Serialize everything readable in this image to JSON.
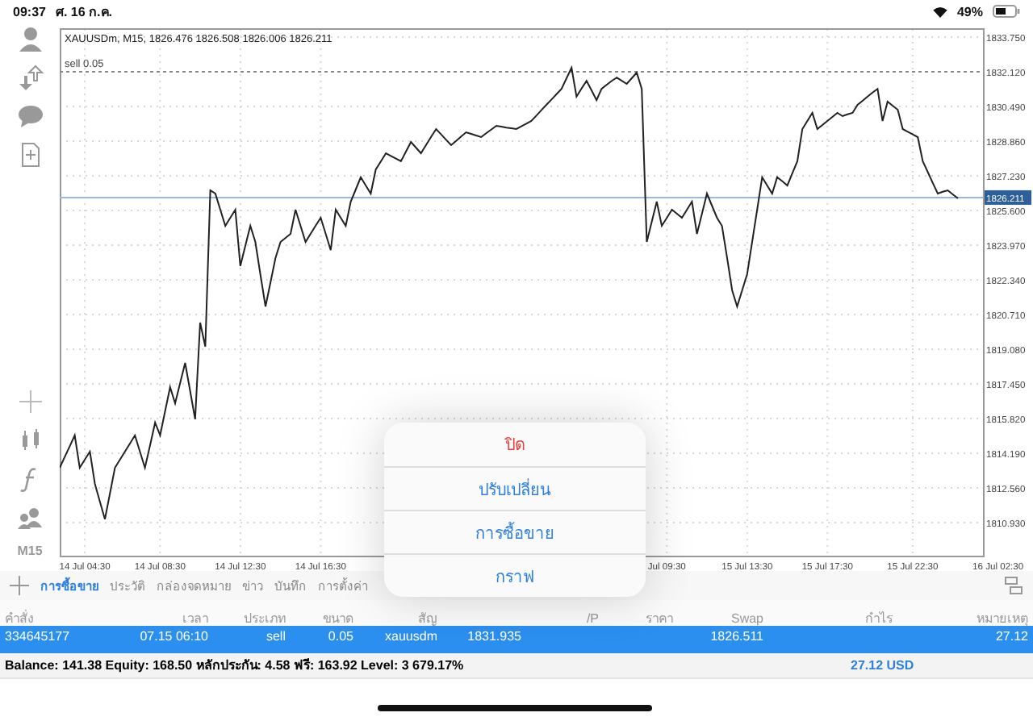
{
  "status_bar": {
    "time": "09:37",
    "date": "ศ. 16 ก.ค.",
    "battery": "49%"
  },
  "toolbar": {
    "timeframe": "M15"
  },
  "chart": {
    "chart_data": {
      "type": "line",
      "title": "XAUUSDm, M15, 1826.476 1826.508 1826.006 1826.211",
      "ylim": [
        1809.34,
        1834.13
      ],
      "grid": true,
      "categories": [
        null,
        null,
        null,
        null,
        null,
        "14 Jul 04:30",
        null,
        null,
        null,
        null,
        null,
        null,
        null,
        null,
        null,
        null,
        null,
        null,
        null,
        null,
        "14 Jul 08:30",
        null,
        null,
        null,
        null,
        null,
        null,
        null,
        null,
        null,
        null,
        null,
        null,
        null,
        null,
        null,
        "14 Jul 12:30",
        null,
        null,
        null,
        null,
        null,
        null,
        null,
        null,
        null,
        null,
        null,
        null,
        null,
        null,
        null,
        "14 Jul 16:30",
        null,
        null,
        null,
        null,
        null,
        null,
        null,
        null,
        null,
        null,
        null,
        null,
        null,
        null,
        null,
        null,
        null,
        null,
        null,
        null,
        null,
        null,
        null,
        null,
        null,
        null,
        null,
        null,
        null,
        null,
        null,
        null,
        null,
        null,
        null,
        null,
        null,
        null,
        null,
        null,
        null,
        null,
        null,
        null,
        null,
        null,
        null,
        null,
        null,
        null,
        null,
        null,
        null,
        null,
        null,
        null,
        null,
        null,
        null,
        null,
        null,
        null,
        null,
        null,
        null,
        null,
        null,
        null,
        "Jul 09:30",
        null,
        null,
        null,
        null,
        null,
        null,
        null,
        null,
        null,
        null,
        null,
        null,
        null,
        null,
        null,
        "15 Jul 13:30",
        null,
        null,
        null,
        null,
        null,
        null,
        null,
        null,
        null,
        null,
        null,
        null,
        null,
        null,
        null,
        "15 Jul 17:30",
        null,
        null,
        null,
        null,
        null,
        null,
        null,
        null,
        null,
        null,
        null,
        null,
        null,
        null,
        null,
        null,
        "15 Jul 22:30",
        null,
        null,
        null,
        null,
        null,
        null,
        null,
        null,
        null,
        null,
        null,
        null,
        null,
        null,
        null,
        null,
        "16 Jul 02:30"
      ],
      "yticks": [
        {
          "value": 1833.75,
          "label": "1833.750"
        },
        {
          "value": 1832.12,
          "label": "1832.120"
        },
        {
          "value": 1830.49,
          "label": "1830.490"
        },
        {
          "value": 1828.86,
          "label": "1828.860"
        },
        {
          "value": 1827.23,
          "label": "1827.230"
        },
        {
          "value": 1825.6,
          "label": "1825.600"
        },
        {
          "value": 1823.97,
          "label": "1823.970"
        },
        {
          "value": 1822.34,
          "label": "1822.340"
        },
        {
          "value": 1820.71,
          "label": "1820.710"
        },
        {
          "value": 1819.08,
          "label": "1819.080"
        },
        {
          "value": 1817.45,
          "label": "1817.450"
        },
        {
          "value": 1815.82,
          "label": "1815.820"
        },
        {
          "value": 1814.19,
          "label": "1814.190"
        },
        {
          "value": 1812.56,
          "label": "1812.560"
        },
        {
          "value": 1810.93,
          "label": "1810.930"
        }
      ],
      "series": [
        {
          "color": "#222222",
          "values": [
            1813.51,
            1814.02,
            1814.52,
            1815.03,
            1813.51,
            1813.89,
            1814.27,
            1812.75,
            1811.92,
            1811.09,
            1812.3,
            1813.51,
            1813.89,
            1814.27,
            1814.65,
            1815.03,
            1814.27,
            1813.51,
            1814.57,
            1815.63,
            1815.03,
            1816.17,
            1817.3,
            1816.54,
            1817.49,
            1818.44,
            1817.12,
            1815.79,
            1820.33,
            1819.2,
            1826.55,
            1826.4,
            1825.64,
            1824.88,
            1825.26,
            1825.64,
            1822.99,
            1823.94,
            1824.88,
            1824.12,
            1822.61,
            1821.09,
            1822.23,
            1823.37,
            1824.12,
            1824.31,
            1824.5,
            1825.64,
            1824.88,
            1824.12,
            1824.5,
            1824.88,
            1825.26,
            1824.5,
            1823.74,
            1825.64,
            1825.26,
            1824.88,
            1826.02,
            1826.59,
            1827.16,
            1826.78,
            1826.4,
            1827.53,
            1827.91,
            1828.29,
            1828.16,
            1828.04,
            1827.91,
            1828.37,
            1828.82,
            1828.56,
            1828.29,
            1828.67,
            1829.05,
            1829.43,
            1829.18,
            1828.92,
            1828.67,
            1828.87,
            1829.08,
            1829.28,
            1829.2,
            1829.13,
            1829.05,
            1829.23,
            1829.4,
            1829.58,
            1829.54,
            1829.5,
            1829.47,
            1829.43,
            1829.56,
            1829.68,
            1829.81,
            1830.06,
            1830.32,
            1830.57,
            1830.82,
            1831.07,
            1831.32,
            1831.82,
            1832.31,
            1830.95,
            1831.33,
            1831.7,
            1831.25,
            1830.79,
            1831.32,
            1831.51,
            1831.7,
            1831.85,
            1831.7,
            1831.55,
            1831.82,
            1832.08,
            1831.32,
            1824.12,
            1825.07,
            1826.02,
            1824.88,
            1825.26,
            1825.64,
            1825.45,
            1825.26,
            1825.64,
            1826.02,
            1824.5,
            1825.45,
            1826.4,
            1825.83,
            1825.26,
            1824.88,
            1823.37,
            1821.85,
            1821.09,
            1821.85,
            1822.61,
            1824.13,
            1825.64,
            1827.16,
            1826.78,
            1826.4,
            1827.16,
            1826.97,
            1826.78,
            1827.35,
            1827.91,
            1829.43,
            1829.81,
            1830.19,
            1829.43,
            1829.62,
            1829.81,
            1830.0,
            1830.19,
            1830.04,
            1830.12,
            1830.19,
            1830.57,
            1830.76,
            1830.95,
            1831.14,
            1831.32,
            1829.81,
            1830.72,
            1830.53,
            1830.34,
            1829.43,
            1829.3,
            1829.18,
            1829.05,
            1827.91,
            1827.41,
            1826.9,
            1826.4,
            1826.48,
            1826.55,
            1826.36,
            1826.17,
            null,
            null,
            null,
            null,
            null,
            null,
            null,
            null
          ]
        }
      ],
      "ref_lines": [
        {
          "axis": "y",
          "value": 1832.12,
          "label": "sell 0.05"
        },
        {
          "axis": "y",
          "value": 1826.211,
          "label": "1826.211"
        }
      ]
    }
  },
  "action_sheet": [
    {
      "label": "ปิด",
      "kind": "destructive"
    },
    {
      "label": "ปรับเปลี่ยน",
      "kind": "default"
    },
    {
      "label": "การซื้อขาย",
      "kind": "default"
    },
    {
      "label": "กราฟ",
      "kind": "default"
    }
  ],
  "tabs": [
    {
      "label": "การซื้อขาย",
      "selected": true
    },
    {
      "label": "ประวัติ",
      "selected": false
    },
    {
      "label": "กล่องจดหมาย",
      "selected": false
    },
    {
      "label": "ข่าว",
      "selected": false
    },
    {
      "label": "บันทึก",
      "selected": false
    },
    {
      "label": "การตั้งค่า",
      "selected": false
    }
  ],
  "table": {
    "columns": [
      "คำสั่ง",
      "เวลา",
      "ประเภท",
      "ขนาด",
      "สัญ",
      "",
      "/P",
      "ราคา",
      "Swap",
      "กำไร",
      "หมายเหตุ"
    ],
    "rows": [
      {
        "selected": true,
        "cells": [
          "334645177",
          "07.15 06:10",
          "sell",
          "0.05",
          "xauusdm",
          "1831.935",
          "",
          "",
          "1826.511",
          "",
          "27.12",
          ""
        ]
      }
    ]
  },
  "summary": {
    "text": "Balance: 141.38 Equity: 168.50 หลักประกัน: 4.58 ฟรี: 163.92 Level: 3 679.17%",
    "profit": "27.12  USD"
  }
}
